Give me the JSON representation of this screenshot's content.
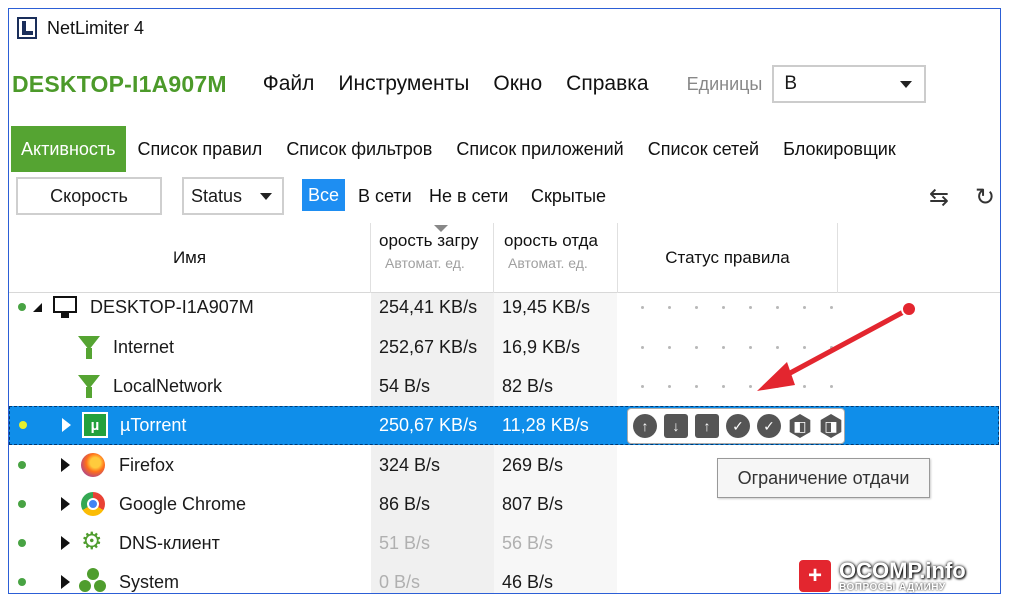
{
  "window": {
    "title": "NetLimiter 4"
  },
  "menubar": {
    "machine": "DESKTOP-I1A907M",
    "items": [
      "Файл",
      "Инструменты",
      "Окно",
      "Справка"
    ],
    "units_label": "Единицы",
    "units_value": "B"
  },
  "tabs": [
    "Активность",
    "Список правил",
    "Список фильтров",
    "Список приложений",
    "Список сетей",
    "Блокировщик"
  ],
  "toolbar": {
    "speed_button": "Скорость",
    "status_select": "Status",
    "filters": [
      "Все",
      "В сети",
      "Не в сети",
      "Скрытые"
    ]
  },
  "columns": {
    "name": "Имя",
    "download": "орость загру",
    "download_sub": "Автомат. ед.",
    "upload": "орость отда",
    "upload_sub": "Автомат. ед.",
    "rule_status": "Статус правила"
  },
  "rows": [
    {
      "name": "DESKTOP-I1A907M",
      "down": "254,41 KB/s",
      "up": "19,45 KB/s"
    },
    {
      "name": "Internet",
      "down": "252,67 KB/s",
      "up": "16,9 KB/s"
    },
    {
      "name": "LocalNetwork",
      "down": "54 B/s",
      "up": "82 B/s"
    },
    {
      "name": "µTorrent",
      "down": "250,67 KB/s",
      "up": "11,28 KB/s",
      "icon_glyph": "µ"
    },
    {
      "name": "Firefox",
      "down": "324 B/s",
      "up": "269 B/s"
    },
    {
      "name": "Google Chrome",
      "down": "86 B/s",
      "up": "807 B/s"
    },
    {
      "name": "DNS-клиент",
      "down": "51 B/s",
      "up": "56 B/s"
    },
    {
      "name": "System",
      "down": "0 B/s",
      "up": "46 B/s"
    }
  ],
  "tooltip": "Ограничение отдачи",
  "watermark": {
    "badge": "+",
    "text": "OCOMP.info",
    "sub": "ВОПРОСЫ АДМИНУ"
  },
  "colors": {
    "accent_green": "#55a432",
    "selection_blue": "#0f8eea",
    "filter_active": "#1e8ef2",
    "annotation_red": "#e3262f"
  }
}
